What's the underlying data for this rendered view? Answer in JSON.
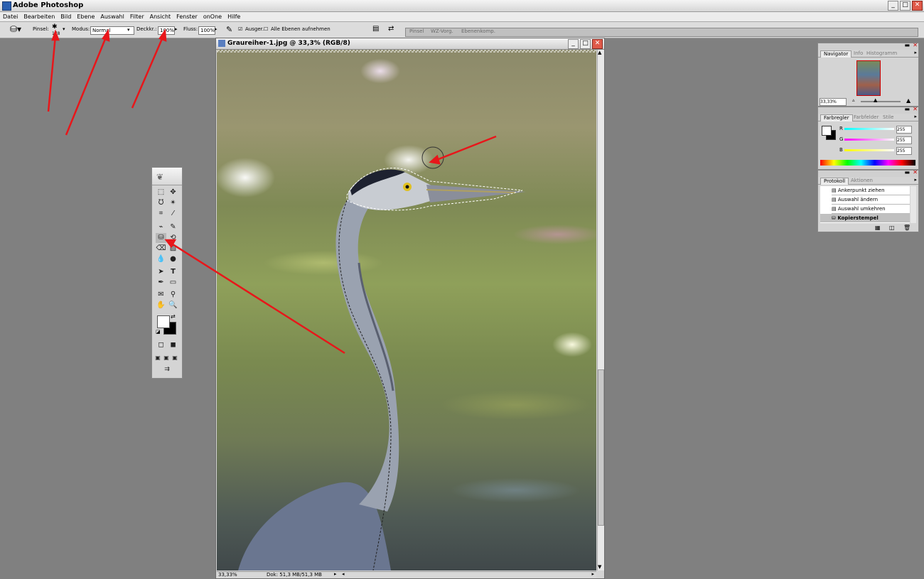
{
  "app": {
    "title": "Adobe Photoshop"
  },
  "menu": [
    "Datei",
    "Bearbeiten",
    "Bild",
    "Ebene",
    "Auswahl",
    "Filter",
    "Ansicht",
    "Fenster",
    "onOne",
    "Hilfe"
  ],
  "options": {
    "brush_label": "Pinsel:",
    "brush_size": "178",
    "mode_label": "Modus:",
    "mode_value": "Normal",
    "opacity_label": "Deckkr.:",
    "opacity_value": "100%",
    "flow_label": "Fluss:",
    "flow_value": "100%",
    "aligned_label": "Ausger.",
    "all_layers_label": "Alle Ebenen aufnehmen"
  },
  "palette_well": [
    "Pinsel",
    "WZ-Vorg.",
    "Ebenenkomp."
  ],
  "document": {
    "title": "Graureiher-1.jpg @ 33,3% (RGB/8)",
    "zoom": "33,33%",
    "doc_size": "Dok: 51,3 MB/51,3 MB"
  },
  "navigator": {
    "tabs": [
      "Navigator",
      "Info",
      "Histogramm"
    ],
    "zoom": "33,33%"
  },
  "color": {
    "tabs": [
      "Farbregler",
      "Farbfelder",
      "Stile"
    ],
    "r_label": "R",
    "g_label": "G",
    "b_label": "B",
    "r": "255",
    "g": "255",
    "b": "255"
  },
  "history": {
    "tabs": [
      "Protokoll",
      "Aktionen"
    ],
    "items": [
      "Ankerpunkt ziehen",
      "Auswahl ändern",
      "Auswahl umkehren",
      "Kopierstempel"
    ]
  },
  "colors": {
    "accent": "#e8161a",
    "workspace": "#808080"
  }
}
